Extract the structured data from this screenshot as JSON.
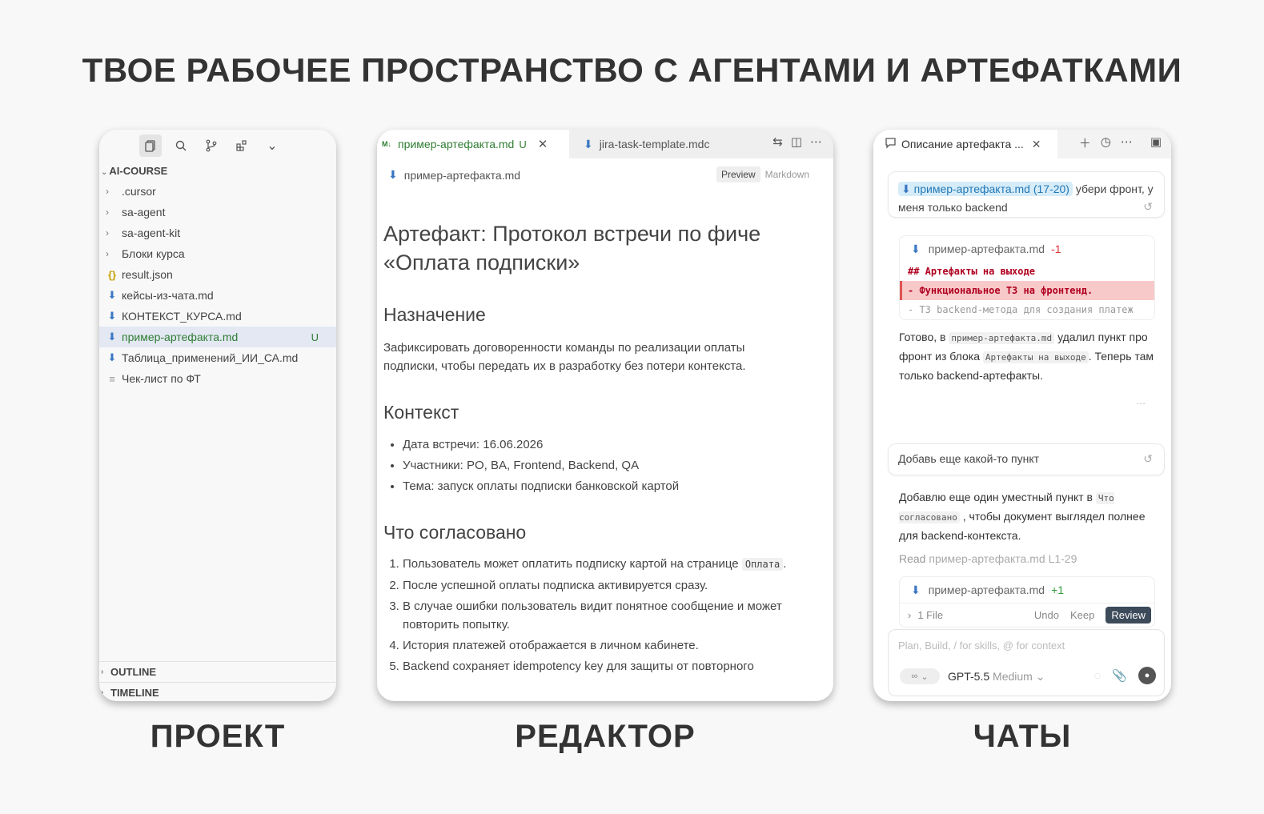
{
  "header": {
    "title": "ТВОЕ РАБОЧЕЕ ПРОСТРАНСТВО С АГЕНТАМИ И АРТЕФАТКАМИ"
  },
  "captions": {
    "project": "ПРОЕКТ",
    "editor": "РЕДАКТОР",
    "chats": "ЧАТЫ"
  },
  "colors": {
    "accent_green": "#2f7d32",
    "md_blue": "#3a77c2",
    "diff_red": "#f8c9c9",
    "chip_blue": "#d6ecf8"
  },
  "project": {
    "root": "AI-COURSE",
    "items": [
      {
        "label": ".cursor",
        "type": "folder",
        "icon": "chevron-right-icon"
      },
      {
        "label": "sa-agent",
        "type": "folder",
        "icon": "chevron-right-icon"
      },
      {
        "label": "sa-agent-kit",
        "type": "folder",
        "icon": "chevron-right-icon"
      },
      {
        "label": "Блоки курса",
        "type": "folder",
        "icon": "chevron-right-icon"
      },
      {
        "label": "result.json",
        "type": "json",
        "icon": "json-file-icon"
      },
      {
        "label": "кейсы-из-чата.md",
        "type": "md",
        "icon": "markdown-file-icon"
      },
      {
        "label": "КОНТЕКСТ_КУРСА.md",
        "type": "md",
        "icon": "markdown-file-icon"
      },
      {
        "label": "пример-артефакта.md",
        "type": "md",
        "icon": "markdown-file-icon",
        "badge": "U",
        "selected": true
      },
      {
        "label": "Таблица_применений_ИИ_СА.md",
        "type": "md",
        "icon": "markdown-file-icon"
      },
      {
        "label": "Чек-лист по ФТ",
        "type": "txt",
        "icon": "text-file-icon"
      }
    ],
    "outline": "OUTLINE",
    "timeline": "TIMELINE"
  },
  "editor": {
    "tabs": [
      {
        "label": "пример-артефакта.md",
        "badge": "M↓",
        "status": "U"
      },
      {
        "label": "jira-task-template.mdc"
      }
    ],
    "breadcrumb": "пример-артефакта.md",
    "view_preview": "Preview",
    "view_markdown": "Markdown",
    "doc": {
      "title": "Артефакт: Протокол встречи по фиче «Оплата подписки»",
      "h_purpose": "Назначение",
      "purpose": "Зафиксировать договоренности команды по реализации оплаты подписки, чтобы передать их в разработку без потери контекста.",
      "h_context": "Контекст",
      "context": [
        "Дата встречи: 16.06.2026",
        "Участники: PO, BA, Frontend, Backend, QA",
        "Тема: запуск оплаты подписки банковской картой"
      ],
      "h_agreed": "Что согласовано",
      "agreed_1_text": "Пользователь может оплатить подписку картой на странице",
      "agreed_1_code": "Оплата",
      "agreed": [
        "После успешной оплаты подписка активируется сразу.",
        "В случае ошибки пользователь видит понятное сообщение и может повторить попытку.",
        "История платежей отображается в личном кабинете.",
        "Backend сохраняет idempotency key для защиты от повторного"
      ]
    }
  },
  "chat": {
    "tab_title": "Описание артефакта ...",
    "msg1_chip": "пример-артефакта.md (17-20)",
    "msg1_text_a": "убери",
    "msg1_text_b": "фронт, у меня только backend",
    "diff1": {
      "file": "пример-артефакта.md",
      "delta": "-1",
      "line_heading": "## Артефакты на выходе",
      "line_removed": "- Функциональное ТЗ на фронтенд.",
      "line_context": "- ТЗ backend-метода для создания платеж"
    },
    "reply1": {
      "a": "Готово, в",
      "code1": "пример-артефакта.md",
      "b": "удалил пункт про фронт из блока",
      "code2": "Артефакты на выходе",
      "c": ". Теперь там только backend-артефакты."
    },
    "more": "...",
    "msg2": "Добавь еще какой-то пункт",
    "reply2": {
      "a": "Добавлю еще один уместный пункт в",
      "code": "Что согласовано",
      "b": ", чтобы документ выглядел полнее для backend-контекста."
    },
    "read_label": "Read",
    "read_file": "пример-артефакта.md L1-29",
    "diff2": {
      "file": "пример-артефакта.md",
      "delta": "+1"
    },
    "files_count": "1 File",
    "undo": "Undo",
    "keep": "Keep",
    "review": "Review",
    "composer_placeholder": "Plan, Build, / for skills, @ for context",
    "mode": "∞",
    "model": "GPT-5.5",
    "model_level": "Medium"
  }
}
